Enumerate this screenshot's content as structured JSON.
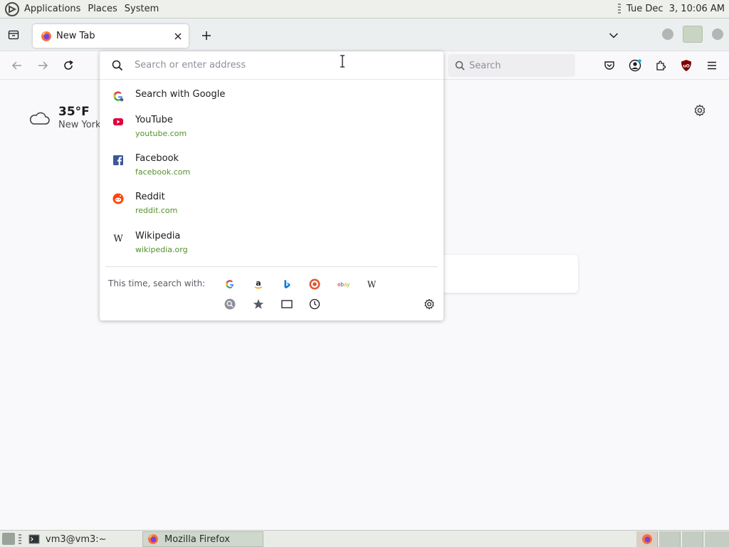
{
  "top_panel": {
    "menus": [
      "Applications",
      "Places",
      "System"
    ],
    "clock": "Tue Dec  3, 10:06 AM"
  },
  "tabs": [
    {
      "title": "New Tab",
      "favicon": "firefox-icon",
      "active": true
    }
  ],
  "urlbar": {
    "placeholder": "Search or enter address",
    "value": ""
  },
  "search_box": {
    "placeholder": "Search"
  },
  "toolbar_icons": [
    "pocket-icon",
    "account-icon",
    "extensions-icon",
    "ublock-origin-icon",
    "menu-icon"
  ],
  "results": [
    {
      "title": "Search with Google",
      "url": "",
      "icon": "google-icon"
    },
    {
      "title": "YouTube",
      "url": "youtube.com",
      "icon": "youtube-icon"
    },
    {
      "title": "Facebook",
      "url": "facebook.com",
      "icon": "facebook-icon"
    },
    {
      "title": "Reddit",
      "url": "reddit.com",
      "icon": "reddit-icon"
    },
    {
      "title": "Wikipedia",
      "url": "wikipedia.org",
      "icon": "wikipedia-icon"
    }
  ],
  "one_offs": {
    "label": "This time, search with:",
    "engines": [
      "google-icon",
      "amazon-icon",
      "bing-icon",
      "duckduckgo-icon",
      "ebay-icon",
      "wikipedia-icon"
    ],
    "modes": [
      "search-history-icon",
      "bookmarks-star-icon",
      "tabs-icon",
      "history-clock-icon"
    ],
    "settings_icon": "gear-icon"
  },
  "weather": {
    "temperature": "35°F",
    "location": "New York",
    "icon": "cloud-icon"
  },
  "taskbar": {
    "items": [
      "vm3@vm3:~",
      "Mozilla Firefox"
    ]
  },
  "colors": {
    "url_green": "#54902b",
    "youtube_red": "#e0003c",
    "facebook_blue": "#1877f2",
    "reddit_orange": "#ff4500",
    "firefox_orange": "#ff7139"
  }
}
